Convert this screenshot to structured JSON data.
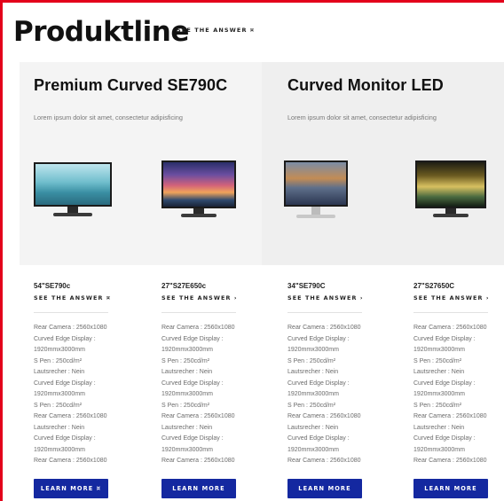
{
  "header": {
    "title": "Produktline",
    "answer_link": "SEE THE ANSWER ¤"
  },
  "panels": [
    {
      "title": "Premium Curved SE790C",
      "subtitle": "Lorem ipsum dolor sit amet, consectetur adipisficing"
    },
    {
      "title": "Curved Monitor LED",
      "subtitle": "Lorem ipsum dolor sit amet, consectetur adipisficing"
    }
  ],
  "products": [
    {
      "model": "54\"SE790c",
      "answer": "SEE THE ANSWER ¤",
      "button": "LEARN MORE ¤",
      "specs": [
        "Rear Camera : 2560x1080",
        "Curved Edge Display :",
        "1920mmx3000mm",
        "S Pen : 250cd/m²",
        "Lautsrecher : Nein",
        "Curved Edge Display :",
        "1920mmx3000mm",
        "S Pen : 250cd/m²",
        "Rear Camera : 2560x1080",
        "Lautsrecher : Nein",
        "Curved Edge Display :",
        "1920mmx3000mm",
        "Rear Camera : 2560x1080"
      ]
    },
    {
      "model": "27\"S27E650c",
      "answer": "SEE THE ANSWER ›",
      "button": "LEARN MORE",
      "specs": [
        "Rear Camera : 2560x1080",
        "Curved Edge Display :",
        "1920mmx3000mm",
        "S Pen : 250cd/m²",
        "Lautsrecher : Nein",
        "Curved Edge Display :",
        "1920mmx3000mm",
        "S Pen : 250cd/m²",
        "Rear Camera : 2560x1080",
        "Lautsrecher : Nein",
        "Curved Edge Display :",
        "1920mmx3000mm",
        "Rear Camera : 2560x1080"
      ]
    },
    {
      "model": "34\"SE790C",
      "answer": "SEE THE ANSWER ›",
      "button": "LEARN MORE",
      "specs": [
        "Rear Camera : 2560x1080",
        "Curved Edge Display :",
        "1920mmx3000mm",
        "S Pen : 250cd/m²",
        "Lautsrecher : Nein",
        "Curved Edge Display :",
        "1920mmx3000mm",
        "S Pen : 250cd/m²",
        "Rear Camera : 2560x1080",
        "Lautsrecher : Nein",
        "Curved Edge Display :",
        "1920mmx3000mm",
        "Rear Camera : 2560x1080"
      ]
    },
    {
      "model": "27\"S27650C",
      "answer": "SEE THE ANSWER ›",
      "button": "LEARN MORE",
      "specs": [
        "Rear Camera : 2560x1080",
        "Curved Edge Display :",
        "1920mmx3000mm",
        "S Pen : 250cd/m²",
        "Lautsrecher : Nein",
        "Curved Edge Display :",
        "1920mmx3000mm",
        "S Pen : 250cd/m²",
        "Rear Camera : 2560x1080",
        "Lautsrecher : Nein",
        "Curved Edge Display :",
        "1920mmx3000mm",
        "Rear Camera : 2560x1080"
      ]
    }
  ],
  "colors": {
    "accent_frame": "#e3001b",
    "button": "#1428a0"
  }
}
